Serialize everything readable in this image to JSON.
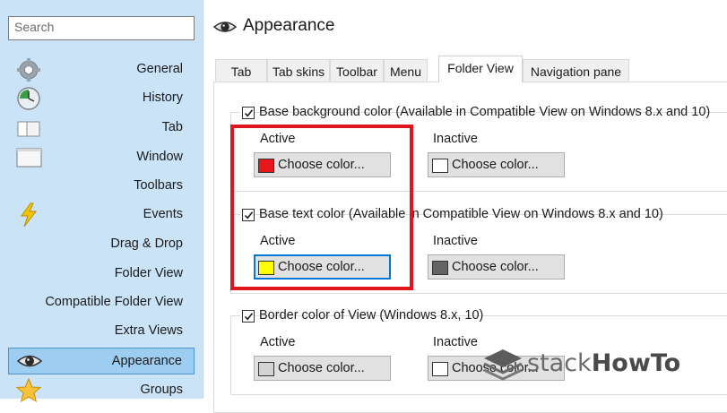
{
  "sidebar": {
    "search_placeholder": "Search",
    "items": [
      {
        "label": "General",
        "icon": "gear-icon"
      },
      {
        "label": "History",
        "icon": "history-clock-icon"
      },
      {
        "label": "Tab",
        "icon": "tab-icon"
      },
      {
        "label": "Window",
        "icon": "window-icon"
      },
      {
        "label": "Toolbars",
        "icon": ""
      },
      {
        "label": "Events",
        "icon": "lightning-icon"
      },
      {
        "label": "Drag & Drop",
        "icon": ""
      },
      {
        "label": "Folder View",
        "icon": ""
      },
      {
        "label": "Compatible Folder View",
        "icon": ""
      },
      {
        "label": "Extra Views",
        "icon": ""
      },
      {
        "label": "Appearance",
        "icon": "eye-icon",
        "selected": true
      },
      {
        "label": "Groups",
        "icon": "star-icon"
      }
    ]
  },
  "main": {
    "title": "Appearance",
    "tabs": [
      "Tab",
      "Tab skins",
      "Toolbar",
      "Menu",
      "Folder View",
      "Navigation pane"
    ],
    "active_tab": "Folder View",
    "groups": [
      {
        "label": "Base background color (Available in Compatible View on Windows 8.x and 10)",
        "checked": true,
        "active_label": "Active",
        "inactive_label": "Inactive",
        "active_button": "Choose color...",
        "inactive_button": "Choose color...",
        "active_color": "#e8151a",
        "inactive_color": "#ffffff"
      },
      {
        "label": "Base text color (Available in Compatible View on Windows 8.x and 10)",
        "checked": true,
        "active_label": "Active",
        "inactive_label": "Inactive",
        "active_button": "Choose color...",
        "inactive_button": "Choose color...",
        "active_color": "#ffff00",
        "inactive_color": "#646464"
      },
      {
        "label": "Border color of View (Windows 8.x, 10)",
        "checked": true,
        "active_label": "Active",
        "inactive_label": "Inactive",
        "active_button": "Choose color...",
        "inactive_button": "Choose color...",
        "active_color": "#d3d3d3",
        "inactive_color": "#ffffff"
      }
    ]
  },
  "watermark": {
    "text_light": "stack",
    "text_bold": "HowTo"
  },
  "colors": {
    "highlight": "#e0161d",
    "sidebar_bg": "#cbe3f7",
    "selected_bg": "#9ecdf2",
    "focus": "#0078d7"
  }
}
